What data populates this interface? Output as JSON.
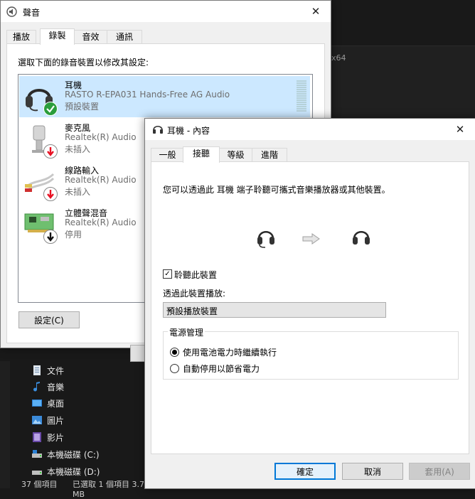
{
  "explorer": {
    "side_text": "x64",
    "nav": [
      {
        "label": "文件",
        "icon": "document-icon"
      },
      {
        "label": "音樂",
        "icon": "music-note-icon"
      },
      {
        "label": "桌面",
        "icon": "desktop-icon"
      },
      {
        "label": "圖片",
        "icon": "picture-icon"
      },
      {
        "label": "影片",
        "icon": "video-icon"
      },
      {
        "label": "本機磁碟 (C:)",
        "icon": "drive-icon"
      },
      {
        "label": "本機磁碟 (D:)",
        "icon": "drive-icon"
      }
    ],
    "status": {
      "count": "37 個項目",
      "selected": "已選取 1 個項目 3.79 MB"
    }
  },
  "sound_window": {
    "title": "聲音",
    "tabs": [
      "播放",
      "錄製",
      "音效",
      "通訊"
    ],
    "active_tab": 1,
    "instruction": "選取下面的錄音裝置以修改其設定:",
    "devices": [
      {
        "name": "耳機",
        "driver": "RASTO R-EPA031 Hands-Free AG Audio",
        "status": "預設裝置",
        "badge": "check"
      },
      {
        "name": "麥克風",
        "driver": "Realtek(R) Audio",
        "status": "未插入",
        "badge": "down-arrow-red"
      },
      {
        "name": "線路輸入",
        "driver": "Realtek(R) Audio",
        "status": "未插入",
        "badge": "down-arrow-red"
      },
      {
        "name": "立體聲混音",
        "driver": "Realtek(R) Audio",
        "status": "停用",
        "badge": "down-arrow-black"
      }
    ],
    "configure_button": "設定(C)"
  },
  "props_window": {
    "title": "耳機 - 內容",
    "tabs": [
      "一般",
      "接聽",
      "等級",
      "進階"
    ],
    "active_tab": 1,
    "description": "您可以透過此 耳機 端子聆聽可攜式音樂播放器或其他裝置。",
    "listen_checkbox": {
      "label": "聆聽此裝置",
      "checked": true
    },
    "playback_label": "透過此裝置播放:",
    "playback_select": "預設播放裝置",
    "power_group": {
      "title": "電源管理",
      "options": [
        {
          "label": "使用電池電力時繼續執行",
          "selected": true
        },
        {
          "label": "自動停用以節省電力",
          "selected": false
        }
      ]
    },
    "buttons": {
      "ok": "確定",
      "cancel": "取消",
      "apply": "套用(A)"
    }
  },
  "colors": {
    "accent": "#0078d7",
    "selection": "#cce8ff",
    "check_green": "#2a9d3c",
    "unplug_red": "#e81123"
  }
}
